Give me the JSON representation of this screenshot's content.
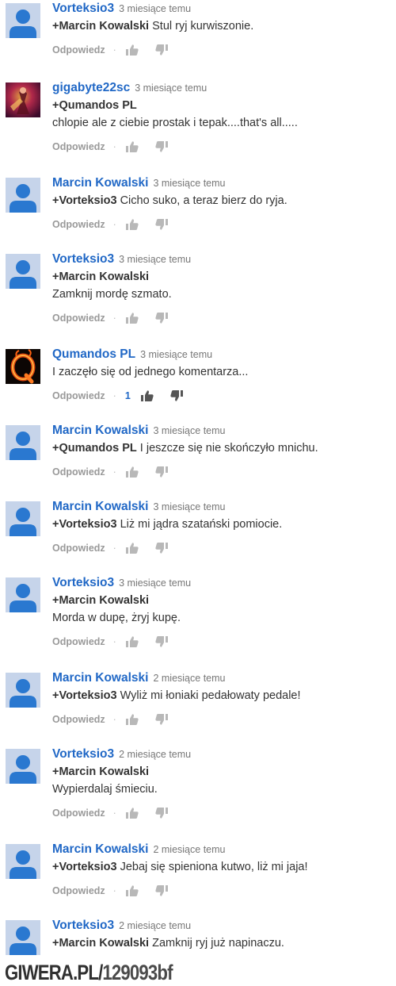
{
  "actions": {
    "reply_label": "Odpowiedz",
    "separator": "·",
    "like_icon": "thumbs-up-icon",
    "dislike_icon": "thumbs-down-icon"
  },
  "comments": [
    {
      "author": "Vorteksio3",
      "time": "3 miesiące temu",
      "avatar": "default",
      "lines": [
        {
          "mention": "+Marcin Kowalski",
          "text": " Stul ryj kurwiszonie."
        }
      ]
    },
    {
      "author": "gigabyte22sc",
      "time": "3 miesiące temu",
      "avatar": "gigabyte",
      "lines": [
        {
          "mention": "+Qumandos PL",
          "text": ""
        },
        {
          "mention": "",
          "text": "chlopie ale z ciebie prostak i tepak....that's all....."
        }
      ]
    },
    {
      "author": "Marcin Kowalski",
      "time": "3 miesiące temu",
      "avatar": "default",
      "lines": [
        {
          "mention": "+Vorteksio3",
          "text": " Cicho suko, a teraz bierz do ryja."
        }
      ]
    },
    {
      "author": "Vorteksio3",
      "time": "3 miesiące temu",
      "avatar": "default",
      "lines": [
        {
          "mention": "+Marcin Kowalski",
          "text": ""
        },
        {
          "mention": "",
          "text": "Zamknij mordę szmato."
        }
      ]
    },
    {
      "author": "Qumandos PL",
      "time": "3 miesiące temu",
      "avatar": "qumandos",
      "likes": "1",
      "lines": [
        {
          "mention": "",
          "text": "I zaczęło się od jednego komentarza..."
        }
      ]
    },
    {
      "author": "Marcin Kowalski",
      "time": "3 miesiące temu",
      "avatar": "default",
      "lines": [
        {
          "mention": "+Qumandos PL",
          "text": " I jeszcze się nie skończyło mnichu."
        }
      ]
    },
    {
      "author": "Marcin Kowalski",
      "time": "3 miesiące temu",
      "avatar": "default",
      "lines": [
        {
          "mention": "+Vorteksio3",
          "text": " Liż mi jądra szatański pomiocie."
        }
      ]
    },
    {
      "author": "Vorteksio3",
      "time": "3 miesiące temu",
      "avatar": "default",
      "lines": [
        {
          "mention": "+Marcin Kowalski",
          "text": ""
        },
        {
          "mention": "",
          "text": "Morda w dupę, żryj kupę."
        }
      ]
    },
    {
      "author": "Marcin Kowalski",
      "time": "2 miesiące temu",
      "avatar": "default",
      "lines": [
        {
          "mention": "+Vorteksio3",
          "text": " Wyliż mi łoniaki pedałowaty pedale!"
        }
      ]
    },
    {
      "author": "Vorteksio3",
      "time": "2 miesiące temu",
      "avatar": "default",
      "lines": [
        {
          "mention": "+Marcin Kowalski",
          "text": ""
        },
        {
          "mention": "",
          "text": "Wypierdalaj śmieciu."
        }
      ]
    },
    {
      "author": "Marcin Kowalski",
      "time": "2 miesiące temu",
      "avatar": "default",
      "lines": [
        {
          "mention": "+Vorteksio3",
          "text": " Jebaj się spieniona kutwo, liż mi jaja!"
        }
      ]
    },
    {
      "author": "Vorteksio3",
      "time": "2 miesiące temu",
      "avatar": "default",
      "no_actions": true,
      "lines": [
        {
          "mention": "+Marcin Kowalski",
          "text": " Zamknij ryj już napinaczu."
        }
      ]
    }
  ],
  "watermark": {
    "site": "GIWERA.PL/",
    "id": "129093bf"
  },
  "colors": {
    "author": "#2168c6",
    "text": "#333333",
    "muted": "#999999",
    "avatar_bg": "#c6d4ea",
    "avatar_fg": "#2a78d0"
  }
}
